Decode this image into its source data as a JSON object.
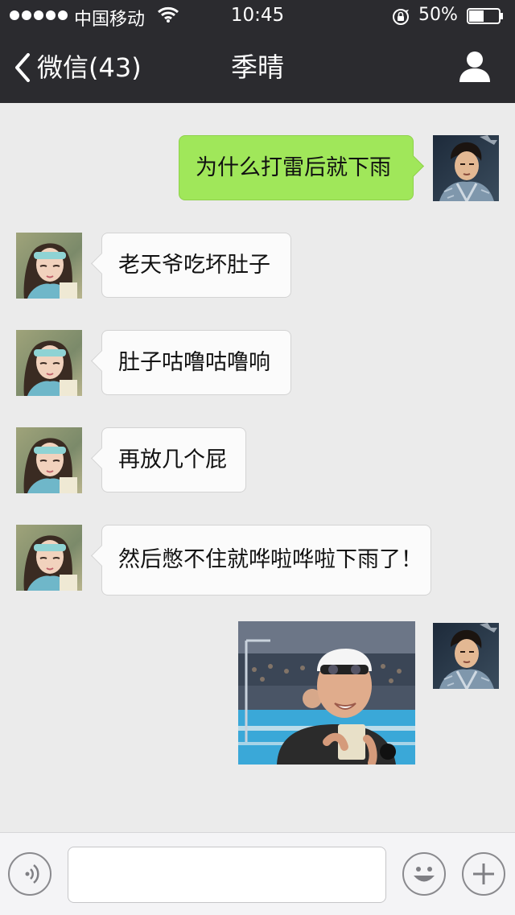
{
  "status_bar": {
    "carrier": "中国移动",
    "time": "10:45",
    "battery": "50%",
    "battery_level": 0.5
  },
  "nav": {
    "back_label": "微信(43)",
    "title": "季晴",
    "back_icon": "chevron-left-icon",
    "profile_icon": "person-icon"
  },
  "messages": [
    {
      "side": "out",
      "text": "为什么打雷后就下雨"
    },
    {
      "side": "in",
      "text": "老天爷吃坏肚子"
    },
    {
      "side": "in",
      "text": "肚子咕噜咕噜响"
    },
    {
      "side": "in",
      "text": "再放几个屁"
    },
    {
      "side": "in",
      "text": "然后憋不住就哗啦哗啦下雨了！"
    },
    {
      "side": "out",
      "type": "image",
      "image": "sticker-image"
    }
  ],
  "input_bar": {
    "voice_icon": "voice-icon",
    "emoji_icon": "emoji-icon",
    "plus_icon": "plus-icon",
    "value": ""
  },
  "colors": {
    "header_bg": "#2b2b2f",
    "chat_bg": "#ebebeb",
    "outgoing_bubble": "#a0e75a",
    "incoming_bubble": "#fbfbfb"
  }
}
